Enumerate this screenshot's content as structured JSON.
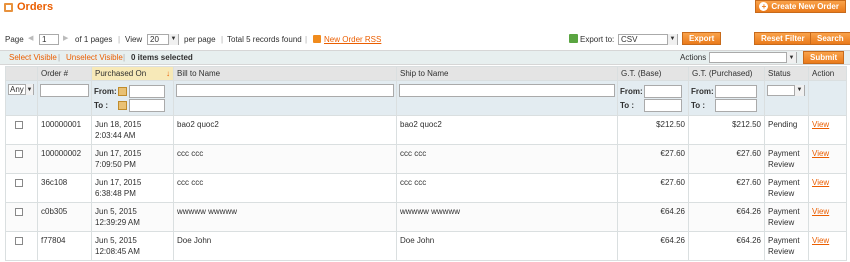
{
  "header": {
    "title": "Orders",
    "create_button": "Create New Order"
  },
  "pager": {
    "page_label": "Page",
    "page_value": "1",
    "of_pages": "of 1 pages",
    "view_label": "View",
    "per_page_value": "20",
    "per_page_label": "per page",
    "total_records": "Total 5 records found",
    "rss_link": "New Order RSS",
    "export_label": "Export to:",
    "export_format": "CSV",
    "export_button": "Export",
    "reset_filter_button": "Reset Filter",
    "search_button": "Search"
  },
  "massaction": {
    "select_visible": "Select Visible",
    "unselect_visible": "Unselect Visible",
    "items_selected": "0 items selected",
    "actions_label": "Actions",
    "submit_button": "Submit"
  },
  "grid": {
    "columns": {
      "order": "Order #",
      "purchased_on": "Purchased On",
      "bill_to": "Bill to Name",
      "ship_to": "Ship to Name",
      "gt_base": "G.T. (Base)",
      "gt_purchased": "G.T. (Purchased)",
      "status": "Status",
      "action": "Action"
    },
    "filter": {
      "massaction_select": "Any",
      "from_label": "From:",
      "to_label": "To :"
    },
    "rows": [
      {
        "order": "100000001",
        "date": "Jun 18, 2015 2:03:44 AM",
        "bill_to": "bao2 quoc2",
        "ship_to": "bao2 quoc2",
        "gt_base": "$212.50",
        "gt_purchased": "$212.50",
        "status": "Pending",
        "action": "View"
      },
      {
        "order": "100000002",
        "date": "Jun 17, 2015 7:09:50 PM",
        "bill_to": "ccc ccc",
        "ship_to": "ccc ccc",
        "gt_base": "€27.60",
        "gt_purchased": "€27.60",
        "status": "Payment Review",
        "action": "View"
      },
      {
        "order": "36c108",
        "date": "Jun 17, 2015 6:38:48 PM",
        "bill_to": "ccc ccc",
        "ship_to": "ccc ccc",
        "gt_base": "€27.60",
        "gt_purchased": "€27.60",
        "status": "Payment Review",
        "action": "View"
      },
      {
        "order": "c0b305",
        "date": "Jun 5, 2015 12:39:29 AM",
        "bill_to": "wwwww wwwww",
        "ship_to": "wwwww wwwww",
        "gt_base": "€64.26",
        "gt_purchased": "€64.26",
        "status": "Payment Review",
        "action": "View"
      },
      {
        "order": "f77804",
        "date": "Jun 5, 2015 12:08:45 AM",
        "bill_to": "Doe John",
        "ship_to": "Doe John",
        "gt_base": "€64.26",
        "gt_purchased": "€64.26",
        "status": "Payment Review",
        "action": "View"
      }
    ]
  }
}
